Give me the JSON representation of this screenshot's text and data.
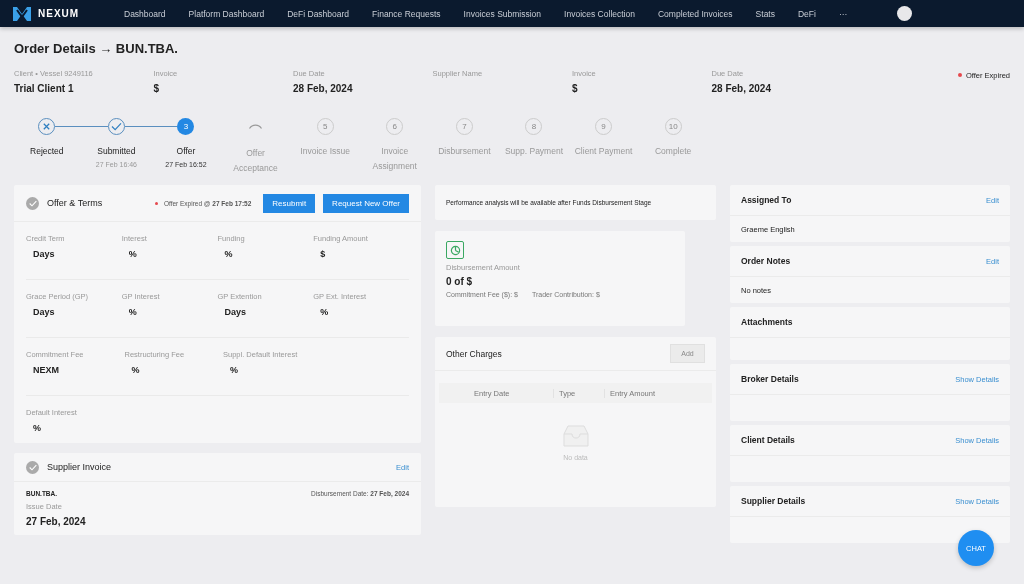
{
  "nav": {
    "brand": "NEXUM",
    "items": [
      {
        "label": "Dashboard",
        "selected": false
      },
      {
        "label": "Platform Dashboard",
        "selected": false
      },
      {
        "label": "DeFi Dashboard",
        "selected": false
      },
      {
        "label": "Finance Requests",
        "selected": false
      },
      {
        "label": "Invoices Submission",
        "selected": false
      },
      {
        "label": "Invoices Collection",
        "selected": false
      },
      {
        "label": "Completed Invoices",
        "selected": false
      },
      {
        "label": "Stats",
        "selected": false
      },
      {
        "label": "DeFi",
        "selected": false
      },
      {
        "label": "···",
        "selected": false
      }
    ]
  },
  "header": {
    "title": "Order Details → BUN.TBA.",
    "status": "Offer Expired",
    "fields": [
      {
        "label": "Client • Vessel 9249116",
        "value": "Trial Client 1"
      },
      {
        "label": "Invoice",
        "value": "$"
      },
      {
        "label": "Due Date",
        "value": "28 Feb, 2024"
      },
      {
        "label": "Supplier Name"
      },
      {
        "label": "Invoice",
        "value": "$"
      },
      {
        "label": "Due Date",
        "value": "28 Feb, 2024"
      }
    ]
  },
  "steps": [
    {
      "kind": "rejected",
      "label": "Rejected"
    },
    {
      "kind": "done",
      "label": "Submitted",
      "time": "27 Feb 16:46"
    },
    {
      "kind": "current",
      "number": "3",
      "label": "Offer",
      "time": "27 Feb 16:52"
    },
    {
      "kind": "loading",
      "label": "Offer Acceptance"
    },
    {
      "kind": "pending",
      "number": "5",
      "label": "Invoice Issue"
    },
    {
      "kind": "pending",
      "number": "6",
      "label": "Invoice Assignment"
    },
    {
      "kind": "pending",
      "number": "7",
      "label": "Disbursement"
    },
    {
      "kind": "pending",
      "number": "8",
      "label": "Supp. Payment"
    },
    {
      "kind": "pending",
      "number": "9",
      "label": "Client Payment"
    },
    {
      "kind": "pending",
      "number": "10",
      "label": "Complete"
    }
  ],
  "offer": {
    "title": "Offer & Terms",
    "expired_label": "Offer Expired @",
    "expired_time": "27 Feb 17:52",
    "buttons": [
      "Resubmit",
      "Request New Offer"
    ],
    "rows": [
      [
        {
          "label": "Credit Term",
          "value": "Days"
        },
        {
          "label": "Interest",
          "value": "%"
        },
        {
          "label": "Funding",
          "value": "%"
        },
        {
          "label": "Funding Amount",
          "value": "$"
        }
      ],
      [
        {
          "label": "Grace Period (GP)",
          "value": "Days"
        },
        {
          "label": "GP Interest",
          "value": "%"
        },
        {
          "label": "GP Extention",
          "value": "Days"
        },
        {
          "label": "GP Ext. Interest",
          "value": "%"
        }
      ],
      [
        {
          "label": "Commitment Fee",
          "value": "NEXM"
        },
        {
          "label": "Restructuring Fee",
          "value": "%"
        },
        {
          "label": "Suppl. Default Interest",
          "value": "%"
        }
      ],
      [
        {
          "label": "Default Interest",
          "value": "%"
        }
      ]
    ]
  },
  "supplier_invoice": {
    "title": "Supplier Invoice",
    "edit": "Edit",
    "reference": "BUN.TBA.",
    "disbursement_label": "Disbursement Date:",
    "disbursement_date": "27 Feb, 2024",
    "issue_label": "Issue Date",
    "issue_date": "27 Feb, 2024"
  },
  "performance_note": "Performance analysis will be available after Funds Disbursement Stage",
  "disbursement": {
    "label": "Disbursement Amount",
    "value": "0 of $",
    "commitment_fee": "Commitment Fee ($): $",
    "trader_contribution": "Trader Contribution: $"
  },
  "other_charges": {
    "title": "Other Charges",
    "add": "Add",
    "columns": [
      "Entry Date",
      "Type",
      "Entry Amount"
    ],
    "empty": "No data"
  },
  "side_cards": [
    {
      "title": "Assigned To",
      "action": "Edit",
      "body": "Graeme English"
    },
    {
      "title": "Order Notes",
      "action": "Edit",
      "body": "No notes"
    },
    {
      "title": "Attachments"
    },
    {
      "title": "Broker Details",
      "action": "Show Details"
    },
    {
      "title": "Client Details",
      "action": "Show Details"
    },
    {
      "title": "Supplier Details",
      "action": "Show Details"
    }
  ],
  "chat": "CHAT"
}
